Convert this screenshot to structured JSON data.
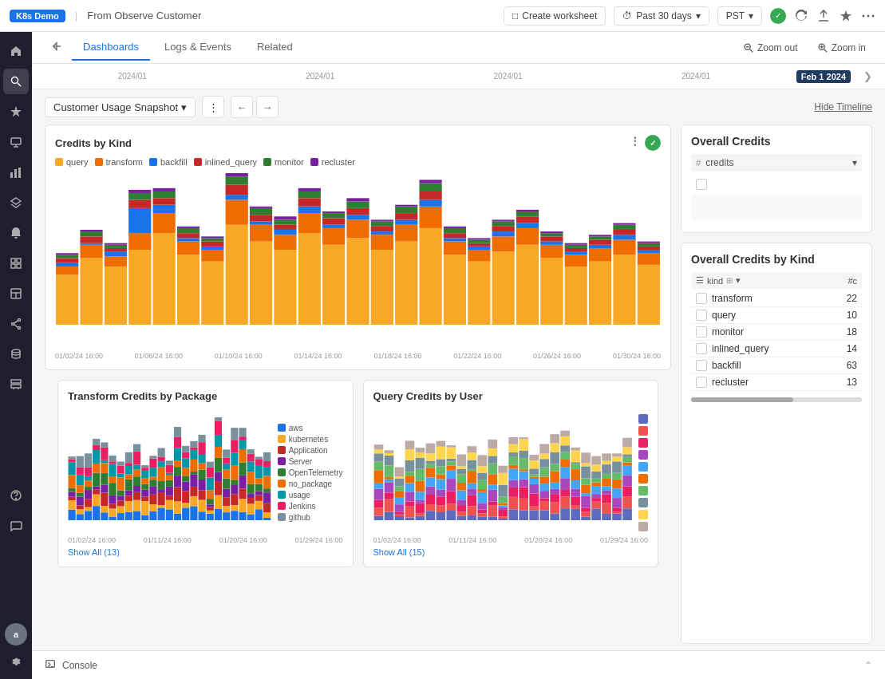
{
  "topbar": {
    "tag": "K8s Demo",
    "separator": "|",
    "title": "From Observe Customer",
    "create_worksheet": "Create worksheet",
    "time_range": "Past 30 days",
    "timezone": "PST",
    "icons": [
      "clock",
      "refresh",
      "upload",
      "star",
      "more"
    ]
  },
  "navtabs": {
    "back_icon": "←",
    "tabs": [
      "Dashboards",
      "Logs & Events",
      "Related"
    ],
    "active_tab": "Dashboards",
    "zoom_out": "Zoom out",
    "zoom_in": "Zoom in"
  },
  "timeline": {
    "dates": [
      "2024/01",
      "2024/01",
      "2024/01",
      "2024/01"
    ],
    "active_date": "Feb 1 2024",
    "hide_timeline": "Hide Timeline",
    "expand_icon": "❯"
  },
  "dashboard_bar": {
    "selector": "Customer Usage Snapshot",
    "hide_timeline": "Hide Timeline"
  },
  "credits_by_kind": {
    "title": "Credits by Kind",
    "legend": [
      {
        "label": "query",
        "color": "#f9a825"
      },
      {
        "label": "transform",
        "color": "#ef6c00"
      },
      {
        "label": "backfill",
        "color": "#1a73e8"
      },
      {
        "label": "inlined_query",
        "color": "#c62828"
      },
      {
        "label": "monitor",
        "color": "#2e7d32"
      },
      {
        "label": "recluster",
        "color": "#7b1fa2"
      }
    ],
    "x_labels": [
      "01/02/24 16:00",
      "01/06/24 16:00",
      "01/10/24 16:00",
      "01/14/24 16:00",
      "01/18/24 16:00",
      "01/22/24 16:00",
      "01/26/24 16:00",
      "01/30/24 16:00"
    ],
    "bars": [
      [
        30,
        5,
        2,
        3,
        2,
        1
      ],
      [
        40,
        8,
        1,
        4,
        3,
        1
      ],
      [
        35,
        6,
        3,
        2,
        2,
        1
      ],
      [
        45,
        10,
        15,
        5,
        4,
        2
      ],
      [
        55,
        12,
        5,
        4,
        4,
        2
      ],
      [
        42,
        8,
        2,
        3,
        3,
        1
      ],
      [
        38,
        7,
        2,
        3,
        2,
        1
      ],
      [
        60,
        15,
        3,
        6,
        5,
        2
      ],
      [
        50,
        10,
        2,
        4,
        4,
        1
      ],
      [
        45,
        9,
        3,
        3,
        3,
        2
      ],
      [
        55,
        12,
        4,
        5,
        4,
        2
      ],
      [
        48,
        10,
        2,
        4,
        3,
        1
      ],
      [
        52,
        11,
        3,
        4,
        4,
        2
      ],
      [
        45,
        9,
        2,
        3,
        3,
        1
      ],
      [
        50,
        10,
        3,
        4,
        4,
        1
      ],
      [
        58,
        13,
        4,
        5,
        5,
        2
      ],
      [
        42,
        8,
        2,
        3,
        3,
        1
      ],
      [
        38,
        7,
        2,
        2,
        2,
        1
      ],
      [
        44,
        9,
        3,
        3,
        3,
        1
      ],
      [
        48,
        10,
        3,
        4,
        3,
        1
      ],
      [
        40,
        8,
        2,
        3,
        2,
        1
      ],
      [
        35,
        7,
        2,
        2,
        2,
        1
      ],
      [
        38,
        8,
        2,
        3,
        2,
        1
      ],
      [
        42,
        9,
        3,
        3,
        3,
        1
      ],
      [
        36,
        7,
        2,
        2,
        2,
        1
      ]
    ]
  },
  "overall_credits": {
    "title": "Overall Credits",
    "column_header": "credits",
    "column_icon": "#",
    "rows": []
  },
  "overall_credits_by_kind": {
    "title": "Overall Credits by Kind",
    "col_kind": "kind",
    "col_credits": "#c",
    "rows": [
      {
        "name": "transform",
        "value": 22
      },
      {
        "name": "query",
        "value": 10
      },
      {
        "name": "monitor",
        "value": 18
      },
      {
        "name": "inlined_query",
        "value": 14
      },
      {
        "name": "backfill",
        "value": 63
      },
      {
        "name": "recluster",
        "value": 13
      }
    ]
  },
  "transform_credits": {
    "title": "Transform Credits by Package",
    "legend": [
      {
        "label": "aws",
        "color": "#1a73e8"
      },
      {
        "label": "kubernetes",
        "color": "#f9a825"
      },
      {
        "label": "Application",
        "color": "#c62828"
      },
      {
        "label": "Server",
        "color": "#7b1fa2"
      },
      {
        "label": "OpenTelemetry",
        "color": "#2e7d32"
      },
      {
        "label": "no_package",
        "color": "#ef6c00"
      },
      {
        "label": "usage",
        "color": "#0097a7"
      },
      {
        "label": "Jenkins",
        "color": "#e91e63"
      },
      {
        "label": "github",
        "color": "#78909c"
      }
    ],
    "show_all": "Show All (13)",
    "x_labels": [
      "01/02/24 16:00",
      "01/11/24 16:00",
      "01/20/24 16:00",
      "01/29/24 16:00"
    ]
  },
  "query_credits": {
    "title": "Query Credits by User",
    "legend": [
      {
        "color": "#5c6bc0"
      },
      {
        "color": "#ef5350"
      },
      {
        "color": "#e91e63"
      },
      {
        "color": "#ab47bc"
      },
      {
        "color": "#42a5f5"
      },
      {
        "color": "#ef6c00"
      },
      {
        "color": "#66bb6a"
      },
      {
        "color": "#78909c"
      },
      {
        "color": "#ffd54f"
      },
      {
        "color": "#bcaaa4"
      }
    ],
    "show_all": "Show All (15)",
    "x_labels": [
      "01/02/24 16:00",
      "01/11/24 16:00",
      "01/20/24 16:00",
      "01/29/24 16:00"
    ]
  },
  "console": {
    "label": "Console",
    "icon": "console-icon",
    "expand_icon": "^"
  },
  "sidebar": {
    "items": [
      {
        "icon": "home",
        "unicode": "⌂"
      },
      {
        "icon": "search",
        "unicode": "🔍"
      },
      {
        "icon": "star",
        "unicode": "★"
      },
      {
        "icon": "monitor",
        "unicode": "◫"
      },
      {
        "icon": "chart",
        "unicode": "📊"
      },
      {
        "icon": "layers",
        "unicode": "⊞"
      },
      {
        "icon": "alert",
        "unicode": "🔔"
      },
      {
        "icon": "grid",
        "unicode": "⊟"
      },
      {
        "icon": "panel",
        "unicode": "▦"
      },
      {
        "icon": "share",
        "unicode": "⑂"
      },
      {
        "icon": "data",
        "unicode": "⊕"
      },
      {
        "icon": "stack",
        "unicode": "⊛"
      },
      {
        "icon": "help",
        "unicode": "?"
      },
      {
        "icon": "chat",
        "unicode": "💬"
      }
    ]
  }
}
